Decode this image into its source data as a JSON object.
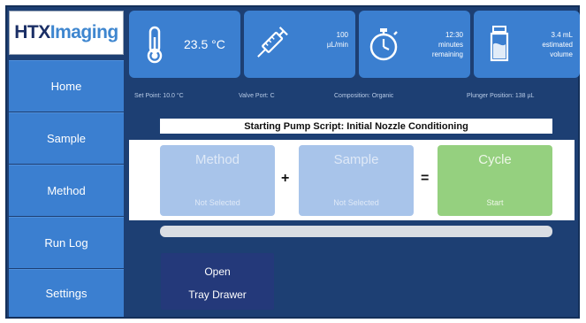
{
  "logo": {
    "part1": "HTX",
    "part2": "Imaging"
  },
  "nav": [
    "Home",
    "Sample",
    "Method",
    "Run Log",
    "Settings"
  ],
  "status": {
    "temperature": {
      "value": "23.5 °C",
      "icon": "thermometer-icon"
    },
    "flow": {
      "value": "100",
      "unit": "µL/min",
      "icon": "syringe-icon"
    },
    "time": {
      "value": "12:30",
      "line2": "minutes",
      "line3": "remaining",
      "icon": "stopwatch-icon"
    },
    "volume": {
      "value": "3.4 mL",
      "line2": "estimated",
      "line3": "volume",
      "icon": "vial-icon"
    }
  },
  "info": {
    "set_point": "Set Point: 10.0 °C",
    "valve_port": "Valve Port: C",
    "composition": "Composition: Organic",
    "plunger": "Plunger Position: 138 µL"
  },
  "banner": "Starting Pump Script: Initial Nozzle Conditioning",
  "equation": {
    "method": {
      "title": "Method",
      "sub": "Not Selected"
    },
    "plus": "+",
    "sample": {
      "title": "Sample",
      "sub": "Not Selected"
    },
    "equals": "=",
    "cycle": {
      "title": "Cycle",
      "sub": "Start"
    }
  },
  "progress_fraction": 0,
  "drawer": {
    "line1": "Open",
    "line2": "Tray Drawer"
  },
  "colors": {
    "background": "#1d3f73",
    "accent": "#3b7fd0",
    "method_box": "#a8c4ea",
    "cycle_box": "#95d07f",
    "drawer_button": "#24397a"
  }
}
